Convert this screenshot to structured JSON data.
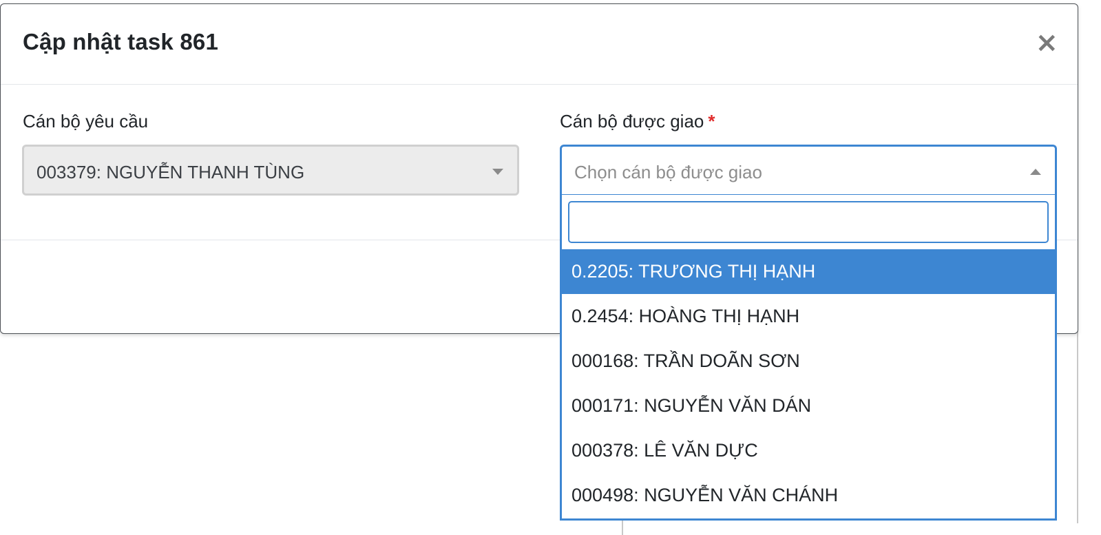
{
  "modal": {
    "title": "Cập nhật task 861",
    "close_label": "×"
  },
  "requester": {
    "label": "Cán bộ yêu cầu",
    "value": "003379: NGUYỄN THANH TÙNG"
  },
  "assignee": {
    "label": "Cán bộ được giao",
    "required_mark": "*",
    "placeholder": "Chọn cán bộ được giao",
    "search_value": "",
    "options": [
      {
        "label": "0.2205: TRƯƠNG THỊ HẠNH",
        "highlighted": true
      },
      {
        "label": "0.2454: HOÀNG THỊ HẠNH",
        "highlighted": false
      },
      {
        "label": "000168: TRẦN DOÃN SƠN",
        "highlighted": false
      },
      {
        "label": "000171: NGUYỄN VĂN DÁN",
        "highlighted": false
      },
      {
        "label": "000378: LÊ VĂN DỰC",
        "highlighted": false
      },
      {
        "label": "000498: NGUYỄN VĂN CHÁNH",
        "highlighted": false
      }
    ]
  },
  "colors": {
    "accent": "#3d86d2",
    "required": "#e02b2b",
    "disabled_bg": "#ececec"
  }
}
